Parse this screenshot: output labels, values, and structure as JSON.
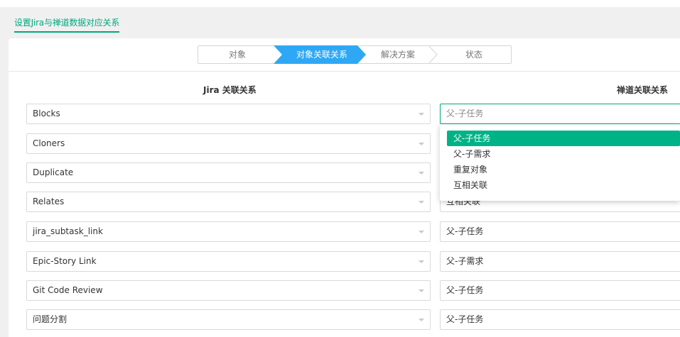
{
  "page": {
    "title": "设置Jira与禅道数据对应关系"
  },
  "steps": [
    {
      "label": "对象",
      "state": "done"
    },
    {
      "label": "对象关联关系",
      "state": "active"
    },
    {
      "label": "解决方案",
      "state": "todo"
    },
    {
      "label": "状态",
      "state": "todo"
    }
  ],
  "colors": {
    "accent": "#00a87e",
    "step_active": "#2ea8f5",
    "dropdown_selected": "#00b386"
  },
  "columns": {
    "jira": "Jira 关联关系",
    "zentao": "禅道关联关系"
  },
  "rows": [
    {
      "jira": "Blocks",
      "zentao": "父-子任务"
    },
    {
      "jira": "Cloners",
      "zentao": ""
    },
    {
      "jira": "Duplicate",
      "zentao": ""
    },
    {
      "jira": "Relates",
      "zentao": "互相关联"
    },
    {
      "jira": "jira_subtask_link",
      "zentao": "父-子任务"
    },
    {
      "jira": "Epic-Story Link",
      "zentao": "父-子需求"
    },
    {
      "jira": "Git Code Review",
      "zentao": "父-子任务"
    },
    {
      "jira": "问题分割",
      "zentao": "父-子任务"
    }
  ],
  "dropdown": {
    "options": [
      "父-子任务",
      "父-子需求",
      "重复对象",
      "互相关联"
    ],
    "selected": "父-子任务"
  }
}
